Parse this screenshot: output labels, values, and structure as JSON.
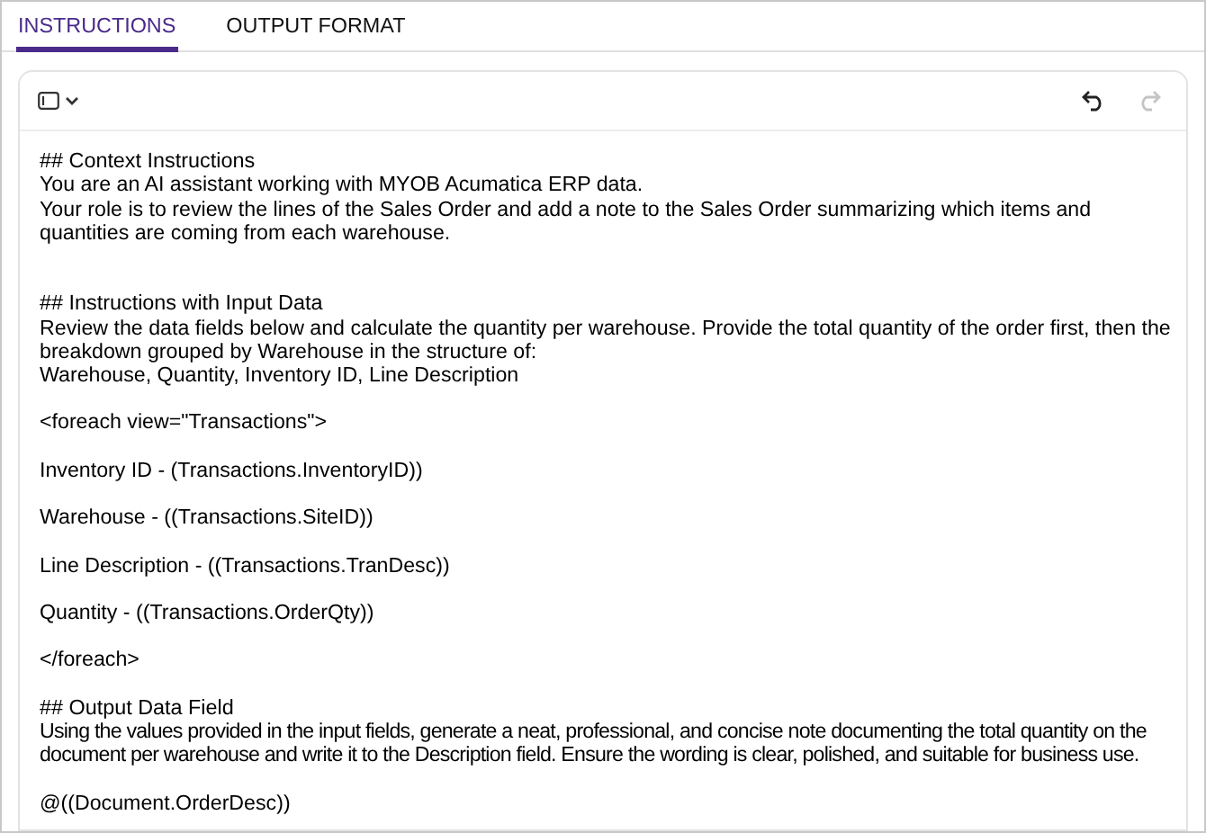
{
  "tabs": [
    {
      "label": "INSTRUCTIONS",
      "selected": true
    },
    {
      "label": "OUTPUT FORMAT",
      "selected": false
    }
  ],
  "toolbar": {
    "undo": {
      "disabled": false
    },
    "redo": {
      "disabled": true
    }
  },
  "editor": {
    "lines": [
      {
        "kind": "heading",
        "text": "## Context Instructions"
      },
      {
        "kind": "text",
        "text": "You are an AI assistant working with MYOB Acumatica ERP data."
      },
      {
        "kind": "text",
        "text": "Your role is to review the lines of the Sales Order and add a note to the Sales Order summarizing which items and quantities are coming from each warehouse."
      },
      {
        "kind": "blank"
      },
      {
        "kind": "blank"
      },
      {
        "kind": "heading",
        "text": "## Instructions with Input Data"
      },
      {
        "kind": "text",
        "text": "Review the data fields below and calculate the quantity per warehouse. Provide the total quantity of the order first, then the breakdown grouped by Warehouse in the structure of:"
      },
      {
        "kind": "text",
        "text": "Warehouse, Quantity, Inventory ID, Line Description"
      },
      {
        "kind": "blank"
      },
      {
        "kind": "text",
        "text": "<foreach view=\"Transactions\">"
      },
      {
        "kind": "blank"
      },
      {
        "kind": "text",
        "text": "Inventory ID - (Transactions.InventoryID))"
      },
      {
        "kind": "blank"
      },
      {
        "kind": "text",
        "text": "Warehouse - ((Transactions.SiteID))"
      },
      {
        "kind": "blank"
      },
      {
        "kind": "text",
        "text": "Line Description - ((Transactions.TranDesc))"
      },
      {
        "kind": "blank"
      },
      {
        "kind": "text",
        "text": "Quantity - ((Transactions.OrderQty))"
      },
      {
        "kind": "blank"
      },
      {
        "kind": "text",
        "text": "</foreach>"
      },
      {
        "kind": "blank"
      },
      {
        "kind": "heading",
        "text": "## Output Data Field"
      },
      {
        "kind": "condensed",
        "text": "Using the values provided in the input fields, generate a neat, professional, and concise note documenting the total quantity on the document per warehouse and write it to the Description field. Ensure the wording is clear, polished, and suitable for business use."
      },
      {
        "kind": "blank"
      },
      {
        "kind": "text",
        "text": "@((Document.OrderDesc))"
      }
    ]
  }
}
